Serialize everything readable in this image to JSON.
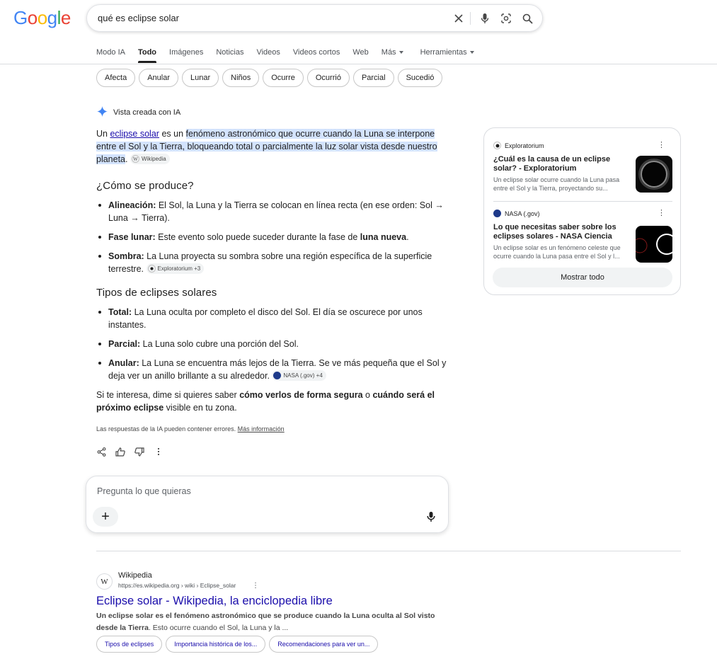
{
  "logo": {
    "letters": [
      "G",
      "o",
      "o",
      "g",
      "l",
      "e"
    ],
    "colors": [
      "#4285f4",
      "#ea4335",
      "#fbbc05",
      "#4285f4",
      "#34a853",
      "#ea4335"
    ]
  },
  "search": {
    "query": "qué es eclipse solar"
  },
  "tabs": [
    {
      "label": "Modo IA",
      "active": false
    },
    {
      "label": "Todo",
      "active": true
    },
    {
      "label": "Imágenes",
      "active": false
    },
    {
      "label": "Noticias",
      "active": false
    },
    {
      "label": "Videos",
      "active": false
    },
    {
      "label": "Videos cortos",
      "active": false
    },
    {
      "label": "Web",
      "active": false
    },
    {
      "label": "Más",
      "active": false
    },
    {
      "label": "Herramientas",
      "active": false
    }
  ],
  "chips": [
    "Afecta",
    "Anular",
    "Lunar",
    "Niños",
    "Ocurre",
    "Ocurrió",
    "Parcial",
    "Sucedió"
  ],
  "ai": {
    "header": "Vista creada con IA",
    "intro_prefix": "Un",
    "intro_link": "eclipse solar",
    "intro_mid": "es un",
    "intro_highlight": "fenómeno astronómico que ocurre cuando la Luna se interpone entre el Sol y la Tierra, bloqueando total o parcialmente la luz solar vista desde nuestro planeta",
    "intro_end": ".",
    "intro_cite": "Wikipedia",
    "section1_title": "¿Cómo se produce?",
    "section1_items": [
      {
        "term": "Alineación:",
        "text": " El Sol, la Luna y la Tierra se colocan en línea recta (en ese orden: Sol → Luna → Tierra)."
      },
      {
        "term": "Fase lunar:",
        "text": " Este evento solo puede suceder durante la fase de ",
        "bold_end": "luna nueva",
        "tail": "."
      },
      {
        "term": "Sombra:",
        "text": " La Luna proyecta su sombra sobre una región específica de la superficie terrestre. ",
        "cite": "Exploratorium +3"
      }
    ],
    "section2_title": "Tipos de eclipses solares",
    "section2_items": [
      {
        "term": "Total:",
        "text": " La Luna oculta por completo el disco del Sol. El día se oscurece por unos instantes."
      },
      {
        "term": "Parcial:",
        "text": " La Luna solo cubre una porción del Sol."
      },
      {
        "term": "Anular:",
        "text": " La Luna se encuentra más lejos de la Tierra. Se ve más pequeña que el Sol y deja ver un anillo brillante a su alrededor. ",
        "cite": "NASA (.gov) +4"
      }
    ],
    "closing_a": "Si te interesa, dime si quieres saber ",
    "closing_b": "cómo verlos de forma segura",
    "closing_c": " o ",
    "closing_d": "cuándo será el próximo eclipse",
    "closing_e": " visible en tu zona.",
    "disclaimer": "Las respuestas de la IA pueden contener errores.",
    "disclaimer_link": "Más información"
  },
  "ask": {
    "placeholder": "Pregunta lo que quieras",
    "plus": "+"
  },
  "sources": [
    {
      "site": "Exploratorium",
      "title": "¿Cuál es la causa de un eclipse solar? - Exploratorium",
      "desc": "Un eclipse solar ocurre cuando la Luna pasa entre el Sol y la Tierra, proyectando su..."
    },
    {
      "site": "NASA (.gov)",
      "title": "Lo que necesitas saber sobre los eclipses solares - NASA Ciencia",
      "desc": "Un eclipse solar es un fenómeno celeste que ocurre cuando la Luna pasa entre el Sol y l..."
    }
  ],
  "show_all": "Mostrar todo",
  "result": {
    "favicon": "W",
    "site_name": "Wikipedia",
    "url": "https://es.wikipedia.org › wiki › Eclipse_solar",
    "title": "Eclipse solar - Wikipedia, la enciclopedia libre",
    "snippet_bold": "Un eclipse solar es el fenómeno astronómico que se produce cuando la Luna oculta al Sol visto desde la Tierra",
    "snippet_rest": ". Esto ocurre cuando el Sol, la Luna y la ...",
    "sublinks": [
      "Tipos de eclipses",
      "Importancia histórica de los...",
      "Recomendaciones para ver un..."
    ]
  }
}
